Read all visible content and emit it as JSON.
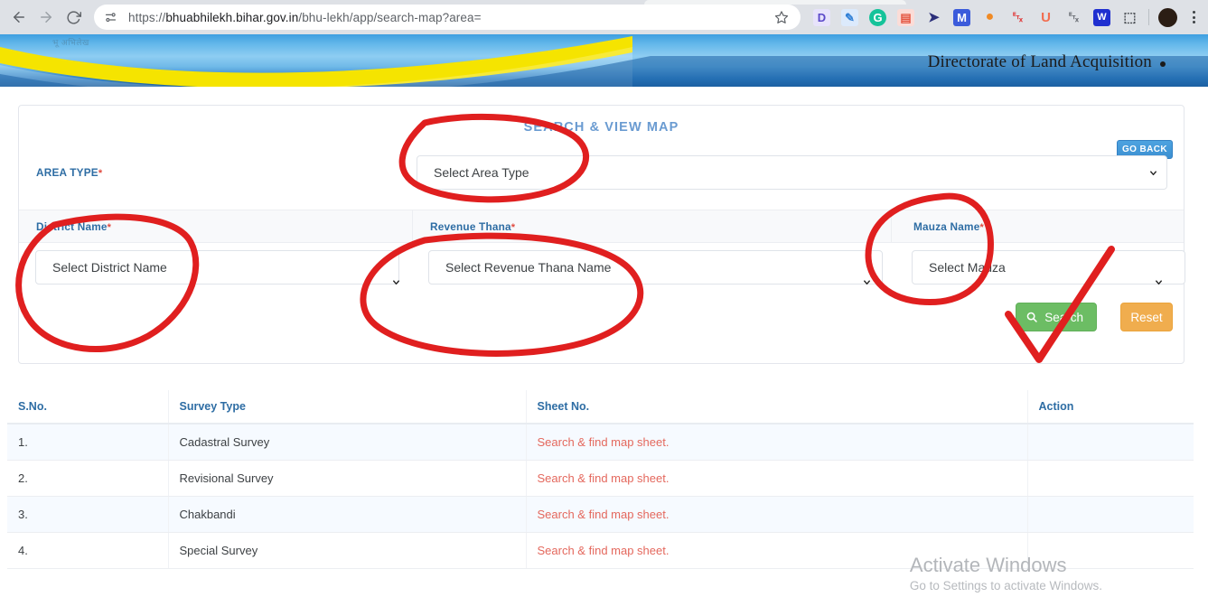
{
  "browser": {
    "url_prefix": "https://",
    "url_domain": "bhuabhilekh.bihar.gov.in",
    "url_path": "/bhu-lekh/app/search-map?area=",
    "back_icon": "back-arrow-icon",
    "forward_icon": "forward-arrow-icon",
    "reload_icon": "reload-icon",
    "site_info_icon": "site-settings-icon",
    "bookmark_icon": "bookmark-star-icon",
    "menu_icon": "three-dot-menu-icon",
    "extensions": [
      {
        "name": "docusign-extension",
        "glyph": "D",
        "bg": "#e7e3fb",
        "fg": "#5b49c9"
      },
      {
        "name": "grammarly-keyboard-extension",
        "glyph": "✎",
        "bg": "#dceafc",
        "fg": "#2f7fd6"
      },
      {
        "name": "grammarly-extension",
        "glyph": "G",
        "bg": "#15c39a",
        "fg": "#ffffff"
      },
      {
        "name": "adobe-acrobat-extension",
        "glyph": "▤",
        "bg": "#fbdcd7",
        "fg": "#e4543f"
      },
      {
        "name": "dark-bird-extension",
        "glyph": "✈",
        "bg": "#ffffff",
        "fg": "#2b2f7a"
      },
      {
        "name": "mega-extension",
        "glyph": "M",
        "bg": "#3b5bdb",
        "fg": "#ffffff"
      },
      {
        "name": "honey-extension",
        "glyph": "◕",
        "bg": "#ffffff",
        "fg": "#f08a24"
      },
      {
        "name": "voice-recorder-red-extension",
        "glyph": "Ἲ4",
        "bg": "#ffffff",
        "fg": "#e03b3b"
      },
      {
        "name": "unacademy-extension",
        "glyph": "U",
        "bg": "#ffffff",
        "fg": "#f26d4f"
      },
      {
        "name": "microphone-extension",
        "glyph": "Ἲ4",
        "bg": "#ffffff",
        "fg": "#6b6f76"
      },
      {
        "name": "wordtune-extension",
        "glyph": "W",
        "bg": "#1f2fd0",
        "fg": "#ffffff"
      },
      {
        "name": "extensions-puzzle-icon",
        "glyph": "⬚",
        "bg": "#ffffff",
        "fg": "#4a4e54"
      }
    ]
  },
  "banner": {
    "faint_text": "भू अभिलेख",
    "title": "Directorate of Land Acquisition"
  },
  "form": {
    "title": "SEARCH & VIEW MAP",
    "go_back_label": "GO BACK",
    "area_type_label": "AREA TYPE",
    "area_type_value": "Select Area Type",
    "district_label": "District Name",
    "district_value": "Select District Name",
    "thana_label": "Revenue Thana",
    "thana_value": "Select Revenue Thana Name",
    "mauza_label": "Mauza Name",
    "mauza_value": "Select Mauza",
    "required_marker": "*",
    "search_label": "Search",
    "search_icon": "magnifier-icon",
    "reset_label": "Reset",
    "chevron_icon": "chevron-down-icon",
    "accent_blue": "#2e6da4",
    "title_blue": "#6a9bd1",
    "search_green": "#6cbd64",
    "reset_orange": "#f0ad4e",
    "required_red": "#e04a3f"
  },
  "table": {
    "headers": [
      "S.No.",
      "Survey Type",
      "Sheet No.",
      "Action"
    ],
    "rows": [
      {
        "sno": "1.",
        "type": "Cadastral Survey",
        "sheet": "Search & find map sheet.",
        "action": ""
      },
      {
        "sno": "2.",
        "type": "Revisional Survey",
        "sheet": "Search & find map sheet.",
        "action": ""
      },
      {
        "sno": "3.",
        "type": "Chakbandi",
        "sheet": "Search & find map sheet.",
        "action": ""
      },
      {
        "sno": "4.",
        "type": "Special Survey",
        "sheet": "Search & find map sheet.",
        "action": ""
      }
    ],
    "link_color": "#e4685d"
  },
  "watermark": {
    "title": "Activate Windows",
    "subtitle": "Go to Settings to activate Windows."
  },
  "annotations": {
    "color": "#e01f1f",
    "marks": [
      {
        "name": "circle-area-type",
        "shape": "ellipse"
      },
      {
        "name": "circle-district-name",
        "shape": "ellipse"
      },
      {
        "name": "circle-revenue-thana",
        "shape": "ellipse"
      },
      {
        "name": "circle-mauza-name",
        "shape": "ellipse"
      },
      {
        "name": "checkmark-search",
        "shape": "check"
      }
    ]
  }
}
